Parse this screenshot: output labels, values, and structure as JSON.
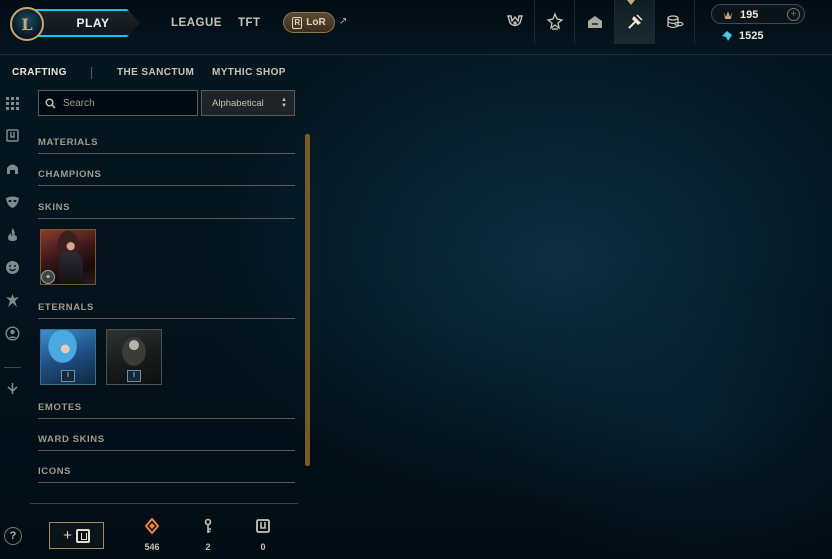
{
  "topnav": {
    "logo_letter": "L",
    "play_label": "PLAY",
    "league_label": "LEAGUE",
    "tft_label": "TFT",
    "lor_label": "LoR",
    "lor_glyph": "R",
    "external_arrow": "↗",
    "icons": [
      "trophy-icon",
      "ranked-icon",
      "collection-icon",
      "loot-icon",
      "store-icon"
    ],
    "active_icon": "loot-icon"
  },
  "wallet": {
    "blue_essence": "195",
    "riot_points": "1525",
    "add_symbol": "+"
  },
  "subtabs": {
    "crafting": "CRAFTING",
    "sanctum": "THE SANCTUM",
    "mythic_shop": "MYTHIC SHOP",
    "active": "CRAFTING"
  },
  "filters": {
    "search_placeholder": "Search",
    "sort_value": "Alphabetical"
  },
  "categories": {
    "materials": "MATERIALS",
    "champions": "CHAMPIONS",
    "skins": "SKINS",
    "eternals": "ETERNALS",
    "emotes": "EMOTES",
    "ward_skins": "WARD SKINS",
    "icons": "ICONS"
  },
  "eternals": {
    "items": [
      {
        "level": "I"
      },
      {
        "level": "I"
      }
    ]
  },
  "bottom": {
    "help": "?",
    "add_symbol": "+",
    "orange_essence": "546",
    "keys": "2",
    "chests": "0"
  },
  "colors": {
    "gold": "#c8aa6e",
    "teal": "#0acbe6",
    "text": "#c8c3b4",
    "orange_essence": "#f0843c",
    "background": "#010a13"
  }
}
